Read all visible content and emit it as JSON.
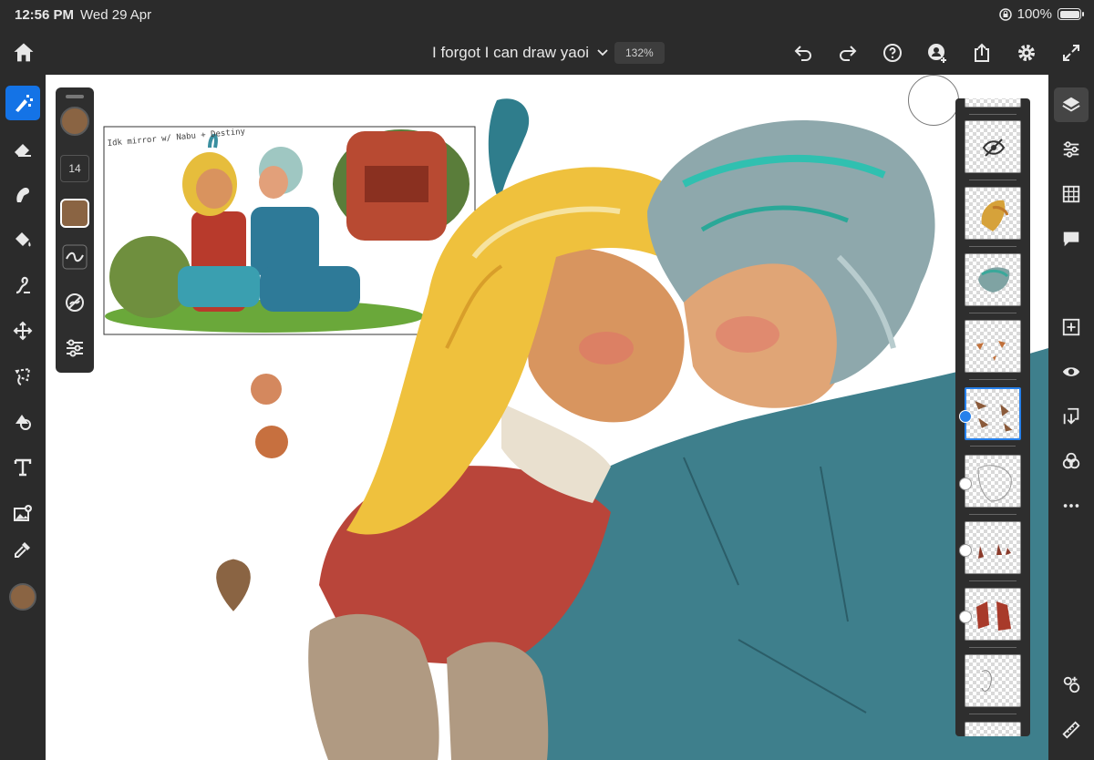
{
  "status": {
    "time": "12:56 PM",
    "date": "Wed 29 Apr",
    "battery": "100%"
  },
  "header": {
    "title": "I forgot I can draw yaoi",
    "zoom": "132%"
  },
  "brush": {
    "size": "14",
    "color": "#8a6443"
  },
  "sketch_note": "Idk mirror w/ Nabu + Destiny",
  "colors": {
    "accent": "#1473e6",
    "brush": "#8a6443",
    "dab1": "#d4885e",
    "dab2": "#c7703f"
  },
  "left_tools": [
    "pixel-brush-icon",
    "eraser-icon",
    "smudge-icon",
    "fill-icon",
    "liquify-icon",
    "move-icon",
    "lasso-icon",
    "transform-icon",
    "text-icon",
    "place-image-icon",
    "eyedropper-icon"
  ],
  "right_tools": [
    "layers-icon",
    "layer-properties-icon",
    "grid-icon",
    "comments-icon",
    "add-layer-icon",
    "visibility-icon",
    "merge-icon",
    "blend-mode-icon",
    "more-icon"
  ]
}
